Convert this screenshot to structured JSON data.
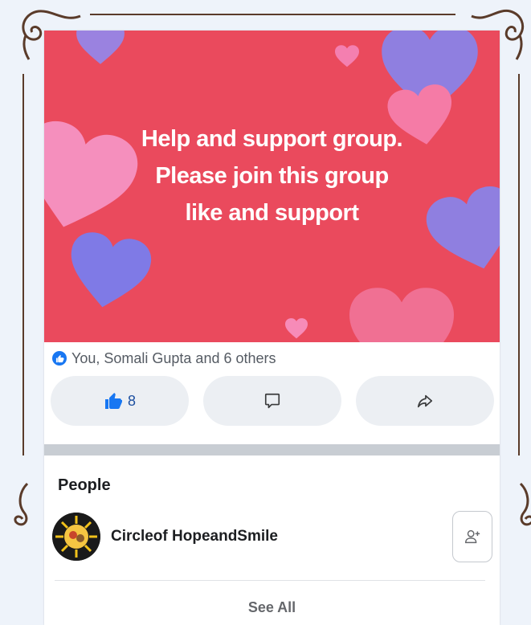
{
  "banner": {
    "line1": "Help and support group.",
    "line2": "Please join this group",
    "line3": "like and support",
    "background": "#ea4a5d"
  },
  "reactions": {
    "icon": "like-icon",
    "text": "You, Somali Gupta and 6 others"
  },
  "actions": {
    "like_count": "8",
    "like_icon": "thumbs-up-icon",
    "comment_icon": "comment-icon",
    "share_icon": "share-icon",
    "accent": "#1877f2"
  },
  "people": {
    "title": "People",
    "items": [
      {
        "name": "Circleof HopeandSmile",
        "action_icon": "add-friend-icon"
      }
    ],
    "see_all": "See All"
  }
}
